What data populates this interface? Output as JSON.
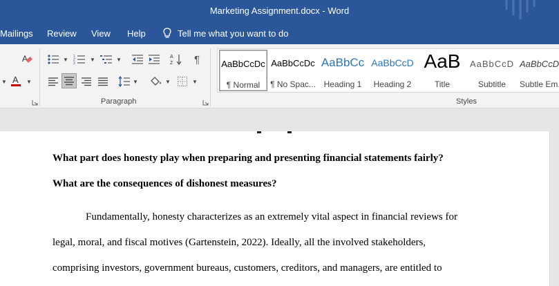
{
  "titlebar": {
    "title": "Marketing Assignment.docx  -  Word"
  },
  "menu": {
    "mailings": "Mailings",
    "review": "Review",
    "view": "View",
    "help": "Help",
    "tell_me": "Tell me what you want to do"
  },
  "ribbon": {
    "paragraph_label": "Paragraph",
    "styles_label": "Styles",
    "styles": [
      {
        "sample": "AaBbCcDc",
        "name": "¶ Normal"
      },
      {
        "sample": "AaBbCcDc",
        "name": "¶ No Spac..."
      },
      {
        "sample": "AaBbCc",
        "name": "Heading 1"
      },
      {
        "sample": "AaBbCcD",
        "name": "Heading 2"
      },
      {
        "sample": "AaB",
        "name": "Title"
      },
      {
        "sample": "AaBbCcD",
        "name": "Subtitle"
      },
      {
        "sample": "AaBbCcD",
        "name": "Subtle Em..."
      }
    ],
    "colors": {
      "font_color": "#c00000",
      "accent": "#2b579a",
      "heading": "#2e74b5"
    }
  },
  "document": {
    "heading_line1": "What part does honesty play when preparing and presenting financial statements fairly?",
    "heading_line2": "What are the consequences of dishonest measures?",
    "para_line1": "Fundamentally, honesty characterizes as an extremely vital aspect in financial reviews for",
    "para_line2": "legal, moral, and fiscal motives (Gartenstein, 2022). Ideally, all the involved stakeholders,",
    "para_line3": "comprising investors, government bureaus, customers, creditors, and managers, are entitled to"
  }
}
